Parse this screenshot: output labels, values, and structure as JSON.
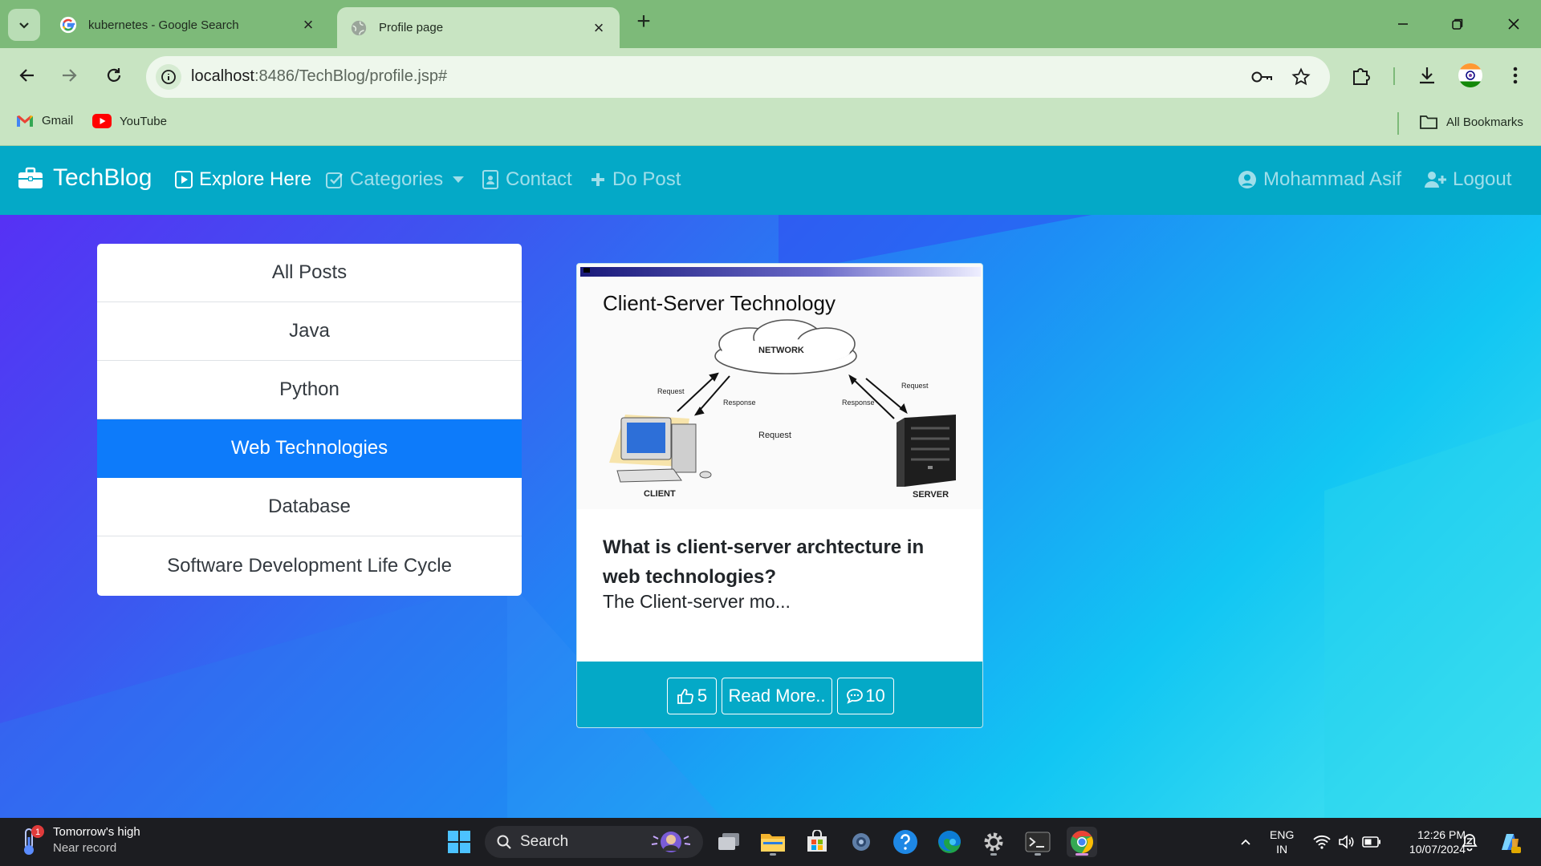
{
  "browser": {
    "tabs": [
      {
        "title": "kubernetes - Google Search",
        "favicon": "google-g-icon"
      },
      {
        "title": "Profile page",
        "favicon": "globe-icon",
        "active": true
      }
    ],
    "url": {
      "host": "localhost",
      "rest": ":8486/TechBlog/profile.jsp#"
    },
    "bookmarks": [
      {
        "label": "Gmail",
        "icon": "gmail-icon"
      },
      {
        "label": "YouTube",
        "icon": "youtube-icon"
      }
    ],
    "all_bookmarks_label": "All Bookmarks",
    "theme_color": "#7dba79"
  },
  "navbar": {
    "brand": "TechBlog",
    "links": {
      "explore": "Explore Here",
      "categories": "Categories",
      "contact": "Contact",
      "do_post": "Do Post"
    },
    "user": "Mohammad Asif",
    "logout": "Logout",
    "color": "#04a9c7"
  },
  "categories": {
    "items": [
      "All Posts",
      "Java",
      "Python",
      "Web Technologies",
      "Database",
      "Software Development Life Cycle"
    ],
    "active_index": 3,
    "active_color": "#0d7bfa"
  },
  "post": {
    "image": {
      "heading": "Client-Server Technology",
      "labels": {
        "network": "NETWORK",
        "request_left": "Request",
        "response_left": "Response",
        "request_right": "Request",
        "response_right": "Response",
        "request_center": "Request",
        "client": "CLIENT",
        "server": "SERVER"
      }
    },
    "title": "What is client-server archtecture in web technologies?",
    "excerpt": "The Client-server mo...",
    "likes": "5",
    "read_more": "Read More..",
    "comments": "10"
  },
  "taskbar": {
    "weather": {
      "line1": "Tomorrow's high",
      "line2": "Near record",
      "badge": "1"
    },
    "search_label": "Search",
    "language": {
      "line1": "ENG",
      "line2": "IN"
    },
    "clock": {
      "time": "12:26 PM",
      "date": "10/07/2024"
    }
  }
}
